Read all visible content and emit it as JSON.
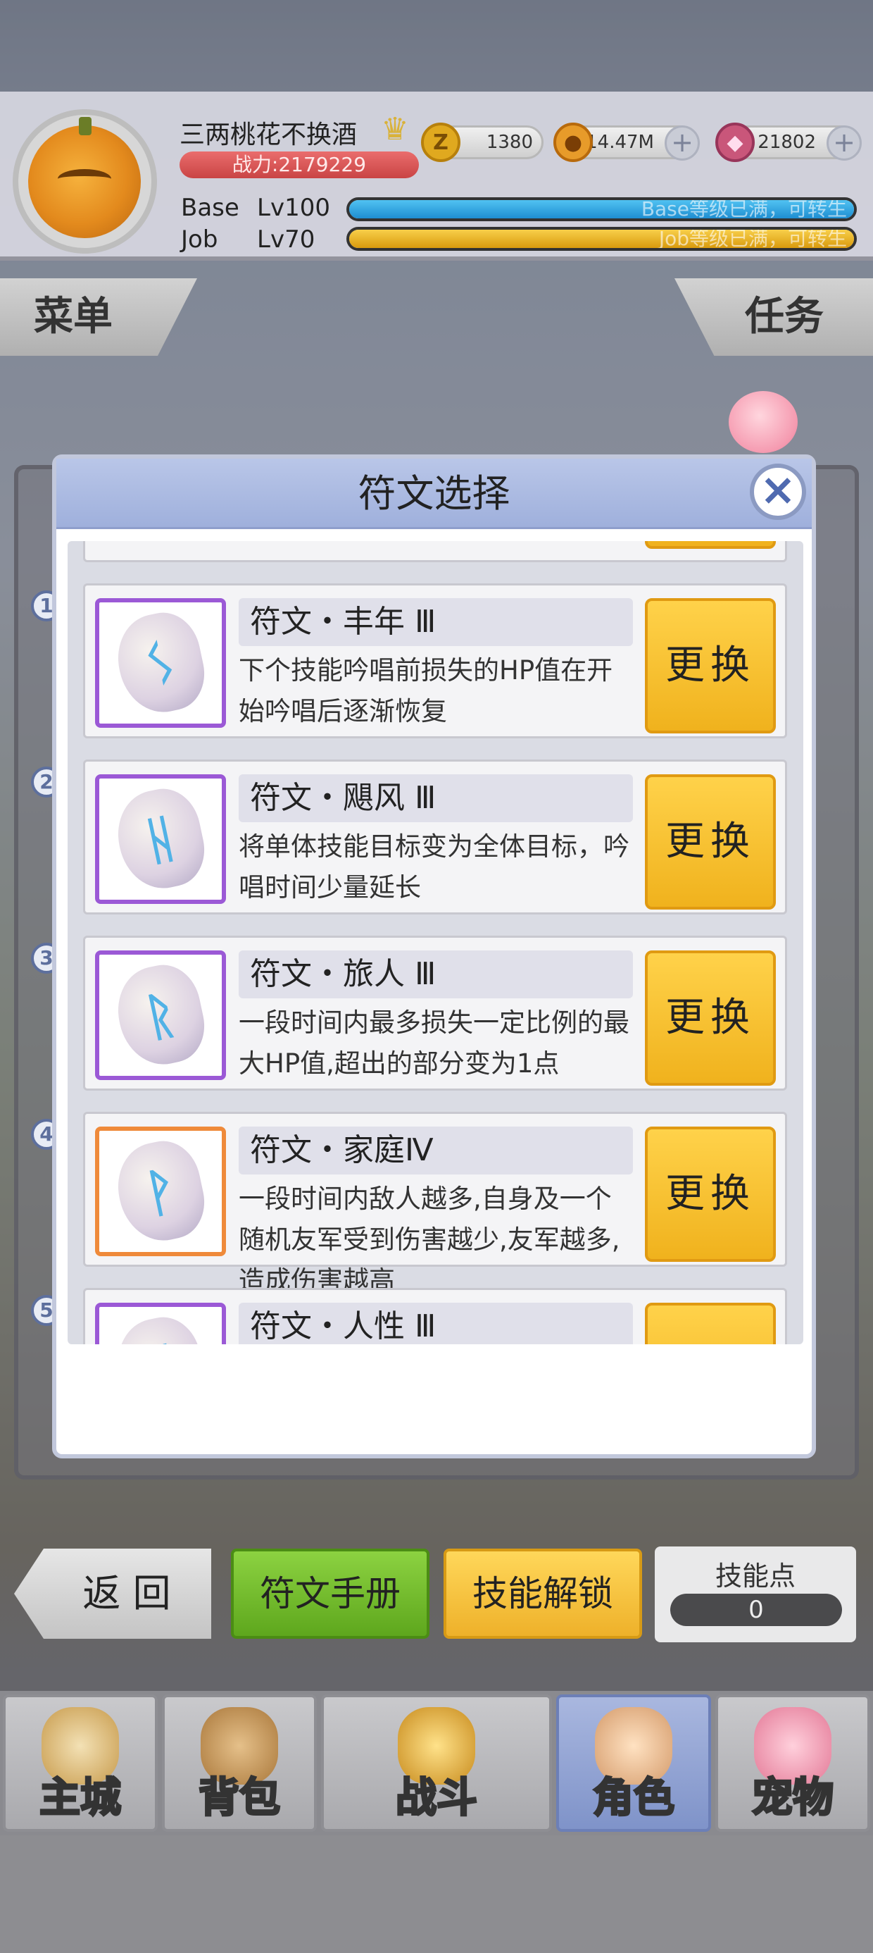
{
  "player": {
    "name": "三两桃花不换酒",
    "power": "战力:2179229",
    "currency_zeny": "1380",
    "currency_gold": "14.47M",
    "currency_gem": "21802",
    "base_label": "Base",
    "base_level": "Lv100",
    "base_status": "Base等级已满，可转生",
    "job_label": "Job",
    "job_level": "Lv70",
    "job_status": "Job等级已满，可转生"
  },
  "side_tabs": {
    "menu": "菜单",
    "task": "任务"
  },
  "modal": {
    "title": "符文选择",
    "close_icon": "close-icon",
    "runes": [
      {
        "name": "符文・丰年 Ⅲ",
        "desc": "下个技能吟唱前损失的HP值在开始吟唱后逐渐恢复",
        "button": "更换",
        "glyph": "ᛊ",
        "frame": "purple"
      },
      {
        "name": "符文・飓风 Ⅲ",
        "desc": "将单体技能目标变为全体目标，吟唱时间少量延长",
        "button": "更换",
        "glyph": "ᚺ",
        "frame": "purple"
      },
      {
        "name": "符文・旅人 Ⅲ",
        "desc": "一段时间内最多损失一定比例的最大HP值,超出的部分变为1点",
        "button": "更换",
        "glyph": "ᚱ",
        "frame": "purple"
      },
      {
        "name": "符文・家庭Ⅳ",
        "desc": "一段时间内敌人越多,自身及一个随机友军受到伤害越少,友军越多,造成伤害越高",
        "button": "更换",
        "glyph": "ᚹ",
        "frame": "orange"
      },
      {
        "name": "符文・人性 Ⅲ",
        "desc": "",
        "button": "",
        "glyph": "ᛗ",
        "frame": "purple"
      }
    ]
  },
  "bottom_actions": {
    "back": "返 回",
    "rune_manual": "符文手册",
    "skill_unlock": "技能解锁",
    "skill_points_label": "技能点",
    "skill_points_value": "0"
  },
  "nav": [
    {
      "label": "主城",
      "icon": "castle-icon",
      "active": false
    },
    {
      "label": "背包",
      "icon": "backpack-icon",
      "active": false
    },
    {
      "label": "战斗",
      "icon": "battle-icon",
      "active": false
    },
    {
      "label": "角色",
      "icon": "character-icon",
      "active": true
    },
    {
      "label": "宠物",
      "icon": "pet-icon",
      "active": false
    }
  ],
  "side_numbers": [
    "1",
    "2",
    "3",
    "4",
    "5"
  ],
  "colors": {
    "base_bar": "#1ea3e6",
    "job_bar": "#f2b21a",
    "swap_button": "#f5c232",
    "green_button": "#6fbe2b",
    "active_nav": "#8a9dd0"
  }
}
